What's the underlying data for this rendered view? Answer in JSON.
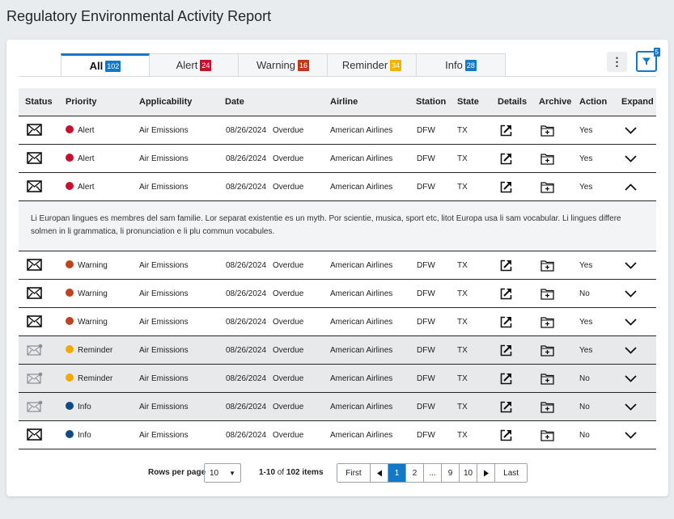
{
  "page": {
    "title": "Regulatory Environmental Activity Report"
  },
  "tabs": [
    {
      "label": "All",
      "count": "102",
      "color": "#1378c6",
      "active": true
    },
    {
      "label": "Alert",
      "count": "24",
      "color": "#c8102e",
      "active": false
    },
    {
      "label": "Warning",
      "count": "16",
      "color": "#c0391b",
      "active": false
    },
    {
      "label": "Reminder",
      "count": "34",
      "color": "#f0b400",
      "active": false
    },
    {
      "label": "Info",
      "count": "28",
      "color": "#1378c6",
      "active": false
    }
  ],
  "toolbar": {
    "menu_icon": "kebab-menu-icon",
    "filter_icon": "filter-icon",
    "filter_count": "5"
  },
  "columns": [
    "Status",
    "Priority",
    "Applicability",
    "Date",
    "Airline",
    "Station",
    "State",
    "Details",
    "Archive",
    "Action",
    "Expand"
  ],
  "priority_colors": {
    "Alert": "#c8102e",
    "Warning": "#c0441b",
    "Reminder": "#f5a800",
    "Info": "#0e4a8a"
  },
  "rows": [
    {
      "status": "unread",
      "priority": "Alert",
      "applicability": "Air Emissions",
      "date": "08/26/2024",
      "due": "Overdue",
      "airline": "American Airlines",
      "station": "DFW",
      "state": "TX",
      "action": "Yes",
      "expanded": false,
      "shaded": false
    },
    {
      "status": "unread",
      "priority": "Alert",
      "applicability": "Air Emissions",
      "date": "08/26/2024",
      "due": "Overdue",
      "airline": "American Airlines",
      "station": "DFW",
      "state": "TX",
      "action": "Yes",
      "expanded": false,
      "shaded": false
    },
    {
      "status": "unread",
      "priority": "Alert",
      "applicability": "Air Emissions",
      "date": "08/26/2024",
      "due": "Overdue",
      "airline": "American Airlines",
      "station": "DFW",
      "state": "TX",
      "action": "Yes",
      "expanded": true,
      "shaded": false
    },
    {
      "status": "unread",
      "priority": "Warning",
      "applicability": "Air Emissions",
      "date": "08/26/2024",
      "due": "Overdue",
      "airline": "American Airlines",
      "station": "DFW",
      "state": "TX",
      "action": "Yes",
      "expanded": false,
      "shaded": false
    },
    {
      "status": "unread",
      "priority": "Warning",
      "applicability": "Air Emissions",
      "date": "08/26/2024",
      "due": "Overdue",
      "airline": "American Airlines",
      "station": "DFW",
      "state": "TX",
      "action": "No",
      "expanded": false,
      "shaded": false
    },
    {
      "status": "unread",
      "priority": "Warning",
      "applicability": "Air Emissions",
      "date": "08/26/2024",
      "due": "Overdue",
      "airline": "American Airlines",
      "station": "DFW",
      "state": "TX",
      "action": "Yes",
      "expanded": false,
      "shaded": false
    },
    {
      "status": "read",
      "priority": "Reminder",
      "applicability": "Air Emissions",
      "date": "08/26/2024",
      "due": "Overdue",
      "airline": "American Airlines",
      "station": "DFW",
      "state": "TX",
      "action": "Yes",
      "expanded": false,
      "shaded": true
    },
    {
      "status": "read",
      "priority": "Reminder",
      "applicability": "Air Emissions",
      "date": "08/26/2024",
      "due": "Overdue",
      "airline": "American Airlines",
      "station": "DFW",
      "state": "TX",
      "action": "No",
      "expanded": false,
      "shaded": true
    },
    {
      "status": "read",
      "priority": "Info",
      "applicability": "Air Emissions",
      "date": "08/26/2024",
      "due": "Overdue",
      "airline": "American Airlines",
      "station": "DFW",
      "state": "TX",
      "action": "No",
      "expanded": false,
      "shaded": true
    },
    {
      "status": "unread",
      "priority": "Info",
      "applicability": "Air Emissions",
      "date": "08/26/2024",
      "due": "Overdue",
      "airline": "American Airlines",
      "station": "DFW",
      "state": "TX",
      "action": "No",
      "expanded": false,
      "shaded": false
    }
  ],
  "expanded_text": "Li Europan lingues es membres del sam familie. Lor separat existentie es un myth. Por scientie, musica, sport etc, litot Europa usa li sam vocabular. Li lingues differe solmen in li grammatica, li pronunciation e li plu commun vocabules.",
  "pagination": {
    "rows_per_page_label": "Rows per page",
    "rows_per_page_value": "10",
    "range_prefix": "1-10",
    "range_of": "of",
    "range_total": "102 items",
    "first_label": "First",
    "last_label": "Last",
    "pages": [
      "1",
      "2",
      "...",
      "9",
      "10"
    ],
    "current_page": "1"
  }
}
